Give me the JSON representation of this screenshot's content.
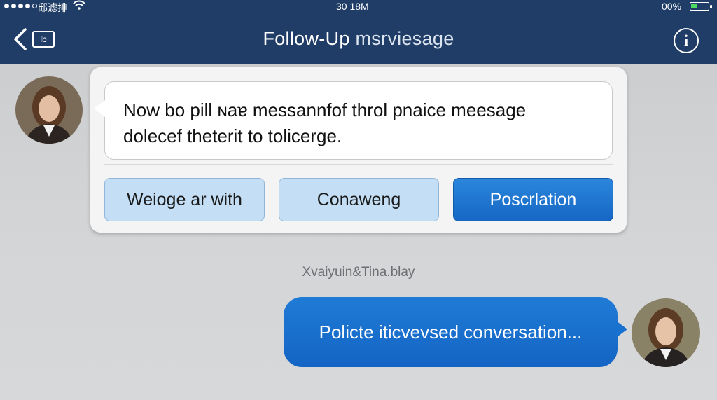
{
  "status_bar": {
    "carrier": "邸滤排",
    "time": "30 18M",
    "battery_percent": "00%",
    "wifi_icon": "wifi-icon"
  },
  "nav": {
    "back_icon": "chevron-left-icon",
    "thumb_label": "lb",
    "title": "Follow-Up",
    "title_suffix": "msrviesage",
    "info_icon": "info-icon",
    "info_glyph": "i"
  },
  "incoming": {
    "line1": "Now bo pill ɴaɐ  messannfof throl pnaice meesage",
    "line2": "dolecef theterit to tolicerge.",
    "buttons": [
      {
        "label": "Weioge ar with"
      },
      {
        "label": "Conaweng"
      },
      {
        "label": "Poscrlation"
      }
    ]
  },
  "meta": "Xvaiyuin&Tina.blay",
  "outgoing": {
    "text": "Policte iticvevsed conversation..."
  },
  "colors": {
    "nav_bg": "#1f3d66",
    "primary_blue": "#1667c4",
    "light_button": "#c4dff5",
    "page_bg": "#d3d5d7"
  }
}
